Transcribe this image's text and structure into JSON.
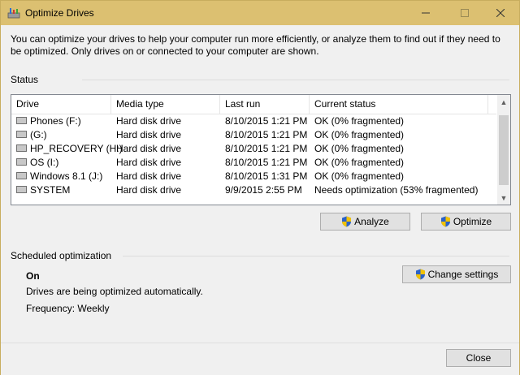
{
  "window": {
    "title": "Optimize Drives",
    "description": "You can optimize your drives to help your computer run more efficiently, or analyze them to find out if they need to be optimized. Only drives on or connected to your computer are shown."
  },
  "status": {
    "label": "Status",
    "columns": [
      "Drive",
      "Media type",
      "Last run",
      "Current status"
    ],
    "drives": [
      {
        "drive": "Phones (F:)",
        "media": "Hard disk drive",
        "last_run": "8/10/2015 1:21 PM",
        "status": "OK (0% fragmented)"
      },
      {
        "drive": "(G:)",
        "media": "Hard disk drive",
        "last_run": "8/10/2015 1:21 PM",
        "status": "OK (0% fragmented)"
      },
      {
        "drive": "HP_RECOVERY (H:)",
        "media": "Hard disk drive",
        "last_run": "8/10/2015 1:21 PM",
        "status": "OK (0% fragmented)"
      },
      {
        "drive": "OS (I:)",
        "media": "Hard disk drive",
        "last_run": "8/10/2015 1:21 PM",
        "status": "OK (0% fragmented)"
      },
      {
        "drive": "Windows 8.1 (J:)",
        "media": "Hard disk drive",
        "last_run": "8/10/2015 1:31 PM",
        "status": "OK (0% fragmented)"
      },
      {
        "drive": "SYSTEM",
        "media": "Hard disk drive",
        "last_run": "9/9/2015 2:55 PM",
        "status": "Needs optimization (53% fragmented)"
      }
    ]
  },
  "actions": {
    "analyze_label": "Analyze",
    "optimize_label": "Optimize"
  },
  "scheduled": {
    "label": "Scheduled optimization",
    "state": "On",
    "detail": "Drives are being optimized automatically.",
    "frequency": "Frequency: Weekly",
    "change_settings_label": "Change settings"
  },
  "footer": {
    "close_label": "Close"
  },
  "icons": {
    "app": "defrag-icon",
    "shield": "uac-shield-icon",
    "drive": "hard-disk-icon"
  },
  "colors": {
    "titlebar": "#dcc071",
    "accent_border": "#c8ad5e"
  }
}
